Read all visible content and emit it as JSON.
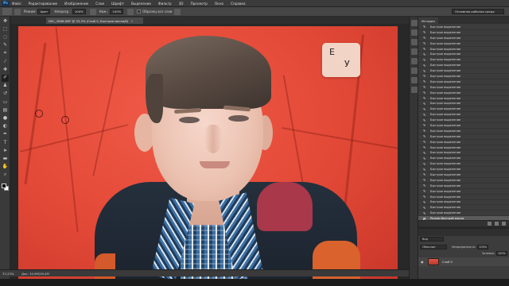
{
  "app": {
    "logo_text": "Ps"
  },
  "menu": [
    "Файл",
    "Редактирование",
    "Изображение",
    "Слои",
    "Шрифт",
    "Выделение",
    "Фильтр",
    "3D",
    "Просмотр",
    "Окно",
    "Справка"
  ],
  "options": {
    "mode_label": "Режим:",
    "mode_value": "Цвет",
    "opacity_label": "Непрозр.:",
    "opacity_value": "100%",
    "flow_label": "Наж.:",
    "flow_value": "100%",
    "sample_label": "Образец все слои",
    "workspace": "Основная рабочая среда"
  },
  "document": {
    "tab_label": "DSC_3808.NEF @ 33,3% (Слой 0, Быстрая маска/8)",
    "tab_close": "✕",
    "key_top": "E",
    "key_bottom": "У"
  },
  "status": {
    "zoom": "33,33%",
    "doc_size": "Док: 34,9M/26,4M"
  },
  "history": {
    "tab_label": "История",
    "item_label": "Быстрое выделение",
    "items": [
      "Быстрое выделение",
      "Быстрое выделение",
      "Быстрое выделение",
      "Быстрое выделение",
      "Быстрое выделение",
      "Быстрое выделение",
      "Быстрое выделение",
      "Быстрое выделение",
      "Быстрое выделение",
      "Быстрое выделение",
      "Быстрое выделение",
      "Быстрое выделение",
      "Быстрое выделение",
      "Быстрое выделение",
      "Быстрое выделение",
      "Быстрое выделение",
      "Быстрое выделение",
      "Быстрое выделение",
      "Быстрое выделение",
      "Быстрое выделение",
      "Быстрое выделение",
      "Быстрое выделение",
      "Быстрое выделение",
      "Быстрое выделение",
      "Быстрое выделение",
      "Быстрое выделение",
      "Быстрое выделение",
      "Быстрое выделение",
      "Быстрое выделение",
      "Быстрое выделение",
      "Быстрое выделение",
      "Быстрое выделение",
      "Быстрое выделение",
      "Быстрое выделение",
      "Быстрое выделение"
    ],
    "current_item": "Режим быстрой маски"
  },
  "layers": {
    "filter": "Вид",
    "blend_mode": "Обычные",
    "opacity_label": "Непрозрачность:",
    "opacity_value": "100%",
    "fill_label": "Заливка:",
    "fill_value": "100%",
    "layer_name": "Слой 0"
  },
  "colors": {
    "mask_red": "#e24836",
    "panel_bg": "#3c3c3c",
    "accent_ps": "#4ab0ff"
  }
}
